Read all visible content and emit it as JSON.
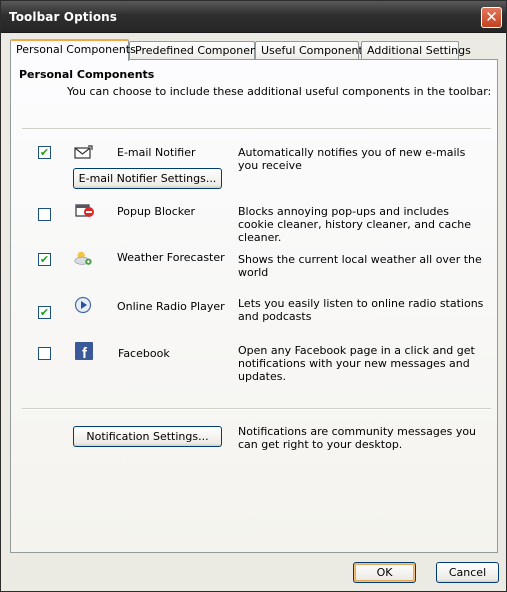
{
  "window": {
    "title": "Toolbar Options"
  },
  "tabs": [
    {
      "label": "Personal Components",
      "active": true
    },
    {
      "label": "Predefined Components",
      "active": false
    },
    {
      "label": "Useful Components",
      "active": false
    },
    {
      "label": "Additional Settings",
      "active": false
    }
  ],
  "section": {
    "title": "Personal Components",
    "description": "You can choose to include these additional useful components in the toolbar:"
  },
  "components": [
    {
      "name": "E-mail Notifier",
      "checked": true,
      "icon": "envelope-icon",
      "description": "Automatically notifies you of new e-mails you receive",
      "settings_button": "E-mail Notifier Settings..."
    },
    {
      "name": "Popup Blocker",
      "checked": false,
      "icon": "popup-blocker-icon",
      "description": "Blocks annoying pop-ups and includes cookie cleaner, history cleaner, and cache cleaner."
    },
    {
      "name": "Weather Forecaster",
      "checked": true,
      "icon": "weather-icon",
      "description": "Shows the current local weather all over the world"
    },
    {
      "name": "Online Radio Player",
      "checked": true,
      "icon": "radio-play-icon",
      "description": "Lets you easily listen to online radio stations and podcasts"
    },
    {
      "name": "Facebook",
      "checked": false,
      "icon": "facebook-icon",
      "description": "Open any Facebook page in a click and get notifications with your new messages and updates."
    }
  ],
  "notifications": {
    "button": "Notification Settings...",
    "description": "Notifications are community messages you can get right to your desktop."
  },
  "footer": {
    "ok": "OK",
    "cancel": "Cancel"
  },
  "colors": {
    "titlebar": "#2f2f2f",
    "close": "#c1421f",
    "tab_active_accent": "#f3a64a",
    "check": "#21a121"
  }
}
